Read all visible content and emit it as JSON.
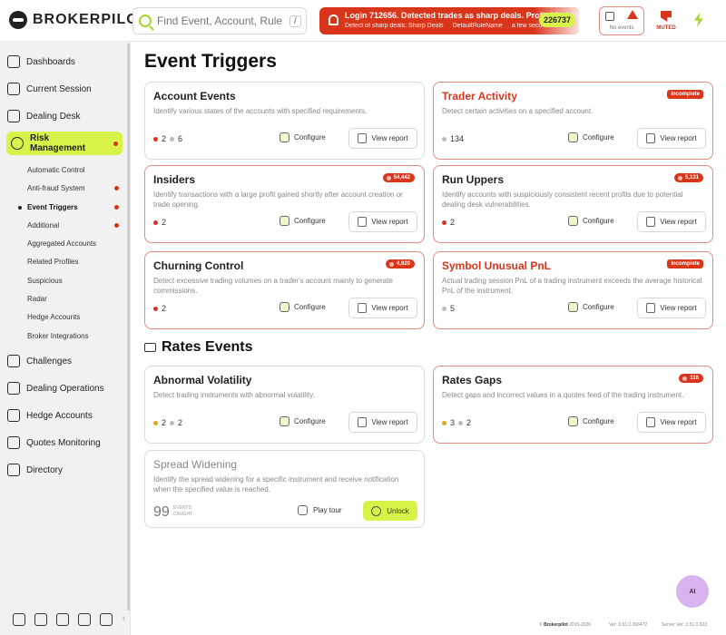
{
  "brand": {
    "name": "BROKERPILOT"
  },
  "search": {
    "placeholder": "Find Event, Account, Rule or sc",
    "shortcut": "/"
  },
  "notification": {
    "title": "Login 712656. Detected trades as sharp deals. Profit $50,000.00...",
    "detail": "Detect of sharp deals: Sharp Deals",
    "rule": "DefaultRuleName",
    "time": "a few second",
    "count": "226737"
  },
  "header": {
    "no_events_label": "No events",
    "muted_label": "MUTED"
  },
  "sidebar": {
    "items": [
      {
        "label": "Dashboards"
      },
      {
        "label": "Current Session"
      },
      {
        "label": "Dealing Desk"
      },
      {
        "label": "Risk Management"
      },
      {
        "label": "Challenges"
      },
      {
        "label": "Dealing Operations"
      },
      {
        "label": "Hedge Accounts"
      },
      {
        "label": "Quotes Monitoring"
      },
      {
        "label": "Directory"
      }
    ],
    "sub_items": [
      {
        "label": "Automatic Control"
      },
      {
        "label": "Anti-fraud System"
      },
      {
        "label": "Event Triggers"
      },
      {
        "label": "Additional"
      },
      {
        "label": "Aggregated Accounts"
      },
      {
        "label": "Related Profiles"
      },
      {
        "label": "Suspicious"
      },
      {
        "label": "Radar"
      },
      {
        "label": "Hedge Accounts"
      },
      {
        "label": "Broker Integrations"
      }
    ]
  },
  "page": {
    "title": "Event Triggers",
    "section2": "Rates Events"
  },
  "labels": {
    "configure": "Configure",
    "view_report": "View report",
    "play_tour": "Play tour",
    "unlock": "Unlock",
    "events_caught": "EVENTS CAUGHT"
  },
  "cards": [
    {
      "title": "Account Events",
      "desc": "Identify various states of the accounts with specified requirements.",
      "s1": "2",
      "s2": "6"
    },
    {
      "title": "Trader Activity",
      "desc": "Detect certain activities on a specified account.",
      "badge": "incomplete",
      "s1": "134"
    },
    {
      "title": "Insiders",
      "desc": "Identify transactions with a large profit gained shortly after account creation or trade opening.",
      "badge": "54,442",
      "s1": "2"
    },
    {
      "title": "Run Uppers",
      "desc": "Identify accounts with suspiciously consistent recent profits due to potential dealing desk vulnerabilities.",
      "badge": "5,131",
      "s1": "2"
    },
    {
      "title": "Churning Control",
      "desc": "Detect excessive trading volumes on a trader's account mainly to generate commissions.",
      "badge": "4,920",
      "s1": "2"
    },
    {
      "title": "Symbol Unusual PnL",
      "desc": "Actual trading session PnL of a trading instrument exceeds the average historical PnL of the instrument.",
      "badge": "incomplete",
      "s1": "5"
    },
    {
      "title": "Abnormal Volatility",
      "desc": "Detect trading instruments with abnormal volatility.",
      "s1": "2",
      "s2": "2"
    },
    {
      "title": "Rates Gaps",
      "desc": "Detect gaps and incorrect values in a quotes feed of the trading instrument.",
      "badge": "116",
      "s1": "3",
      "s2": "2"
    },
    {
      "title": "Spread Widening",
      "desc": "Identify the spread widening for a specific instrument and receive notification when the specified value is reached.",
      "s1": "99"
    }
  ],
  "ai": {
    "label": "AI"
  },
  "footer": {
    "brand": "Brokerpilot",
    "years": "2015-2026",
    "version": "Ver: 3.51.0.266472",
    "server": "Server Ver: 3.51.0.623"
  }
}
